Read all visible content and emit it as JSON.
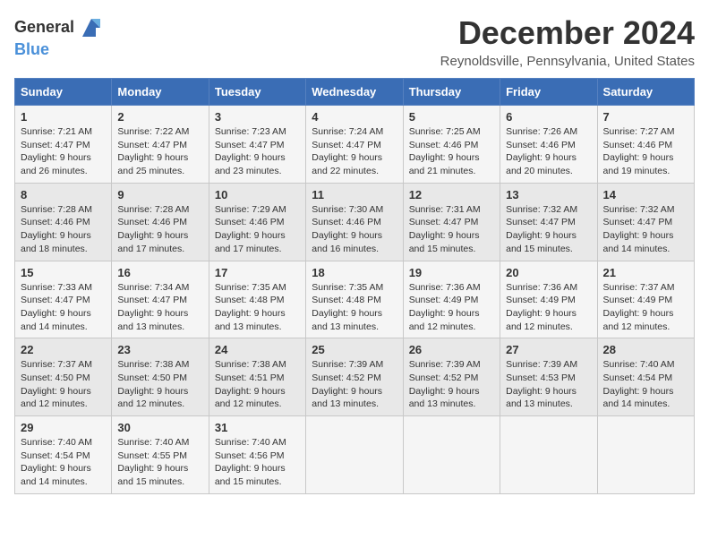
{
  "header": {
    "logo_general": "General",
    "logo_blue": "Blue",
    "month_title": "December 2024",
    "location": "Reynoldsville, Pennsylvania, United States"
  },
  "days_of_week": [
    "Sunday",
    "Monday",
    "Tuesday",
    "Wednesday",
    "Thursday",
    "Friday",
    "Saturday"
  ],
  "weeks": [
    [
      {
        "day": "1",
        "sunrise": "7:21 AM",
        "sunset": "4:47 PM",
        "daylight": "9 hours and 26 minutes."
      },
      {
        "day": "2",
        "sunrise": "7:22 AM",
        "sunset": "4:47 PM",
        "daylight": "9 hours and 25 minutes."
      },
      {
        "day": "3",
        "sunrise": "7:23 AM",
        "sunset": "4:47 PM",
        "daylight": "9 hours and 23 minutes."
      },
      {
        "day": "4",
        "sunrise": "7:24 AM",
        "sunset": "4:47 PM",
        "daylight": "9 hours and 22 minutes."
      },
      {
        "day": "5",
        "sunrise": "7:25 AM",
        "sunset": "4:46 PM",
        "daylight": "9 hours and 21 minutes."
      },
      {
        "day": "6",
        "sunrise": "7:26 AM",
        "sunset": "4:46 PM",
        "daylight": "9 hours and 20 minutes."
      },
      {
        "day": "7",
        "sunrise": "7:27 AM",
        "sunset": "4:46 PM",
        "daylight": "9 hours and 19 minutes."
      }
    ],
    [
      {
        "day": "8",
        "sunrise": "7:28 AM",
        "sunset": "4:46 PM",
        "daylight": "9 hours and 18 minutes."
      },
      {
        "day": "9",
        "sunrise": "7:28 AM",
        "sunset": "4:46 PM",
        "daylight": "9 hours and 17 minutes."
      },
      {
        "day": "10",
        "sunrise": "7:29 AM",
        "sunset": "4:46 PM",
        "daylight": "9 hours and 17 minutes."
      },
      {
        "day": "11",
        "sunrise": "7:30 AM",
        "sunset": "4:46 PM",
        "daylight": "9 hours and 16 minutes."
      },
      {
        "day": "12",
        "sunrise": "7:31 AM",
        "sunset": "4:47 PM",
        "daylight": "9 hours and 15 minutes."
      },
      {
        "day": "13",
        "sunrise": "7:32 AM",
        "sunset": "4:47 PM",
        "daylight": "9 hours and 15 minutes."
      },
      {
        "day": "14",
        "sunrise": "7:32 AM",
        "sunset": "4:47 PM",
        "daylight": "9 hours and 14 minutes."
      }
    ],
    [
      {
        "day": "15",
        "sunrise": "7:33 AM",
        "sunset": "4:47 PM",
        "daylight": "9 hours and 14 minutes."
      },
      {
        "day": "16",
        "sunrise": "7:34 AM",
        "sunset": "4:47 PM",
        "daylight": "9 hours and 13 minutes."
      },
      {
        "day": "17",
        "sunrise": "7:35 AM",
        "sunset": "4:48 PM",
        "daylight": "9 hours and 13 minutes."
      },
      {
        "day": "18",
        "sunrise": "7:35 AM",
        "sunset": "4:48 PM",
        "daylight": "9 hours and 13 minutes."
      },
      {
        "day": "19",
        "sunrise": "7:36 AM",
        "sunset": "4:49 PM",
        "daylight": "9 hours and 12 minutes."
      },
      {
        "day": "20",
        "sunrise": "7:36 AM",
        "sunset": "4:49 PM",
        "daylight": "9 hours and 12 minutes."
      },
      {
        "day": "21",
        "sunrise": "7:37 AM",
        "sunset": "4:49 PM",
        "daylight": "9 hours and 12 minutes."
      }
    ],
    [
      {
        "day": "22",
        "sunrise": "7:37 AM",
        "sunset": "4:50 PM",
        "daylight": "9 hours and 12 minutes."
      },
      {
        "day": "23",
        "sunrise": "7:38 AM",
        "sunset": "4:50 PM",
        "daylight": "9 hours and 12 minutes."
      },
      {
        "day": "24",
        "sunrise": "7:38 AM",
        "sunset": "4:51 PM",
        "daylight": "9 hours and 12 minutes."
      },
      {
        "day": "25",
        "sunrise": "7:39 AM",
        "sunset": "4:52 PM",
        "daylight": "9 hours and 13 minutes."
      },
      {
        "day": "26",
        "sunrise": "7:39 AM",
        "sunset": "4:52 PM",
        "daylight": "9 hours and 13 minutes."
      },
      {
        "day": "27",
        "sunrise": "7:39 AM",
        "sunset": "4:53 PM",
        "daylight": "9 hours and 13 minutes."
      },
      {
        "day": "28",
        "sunrise": "7:40 AM",
        "sunset": "4:54 PM",
        "daylight": "9 hours and 14 minutes."
      }
    ],
    [
      {
        "day": "29",
        "sunrise": "7:40 AM",
        "sunset": "4:54 PM",
        "daylight": "9 hours and 14 minutes."
      },
      {
        "day": "30",
        "sunrise": "7:40 AM",
        "sunset": "4:55 PM",
        "daylight": "9 hours and 15 minutes."
      },
      {
        "day": "31",
        "sunrise": "7:40 AM",
        "sunset": "4:56 PM",
        "daylight": "9 hours and 15 minutes."
      },
      null,
      null,
      null,
      null
    ]
  ],
  "labels": {
    "sunrise": "Sunrise:",
    "sunset": "Sunset:",
    "daylight": "Daylight:"
  }
}
